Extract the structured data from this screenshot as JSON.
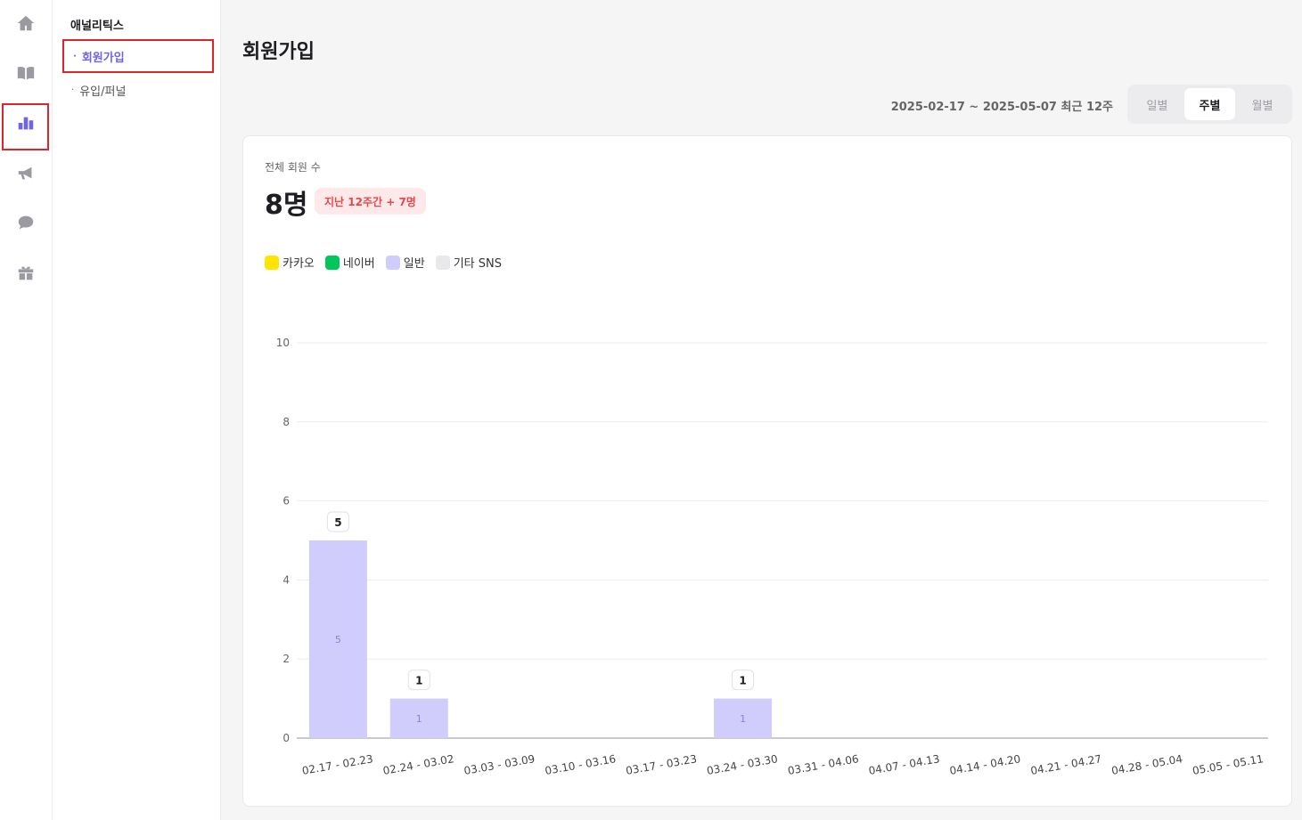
{
  "rail": {
    "items": [
      {
        "icon": "home-icon",
        "name": "rail-home"
      },
      {
        "icon": "book-icon",
        "name": "rail-book"
      },
      {
        "icon": "bar-chart-icon",
        "name": "rail-analytics",
        "active": true
      },
      {
        "icon": "megaphone-icon",
        "name": "rail-marketing"
      },
      {
        "icon": "chat-bubble-icon",
        "name": "rail-chat"
      },
      {
        "icon": "gift-icon",
        "name": "rail-gift"
      }
    ]
  },
  "subnav": {
    "title": "애널리틱스",
    "items": [
      {
        "label": "회원가입",
        "active": true
      },
      {
        "label": "유입/퍼널",
        "active": false
      }
    ]
  },
  "page": {
    "title": "회원가입",
    "range_text": "2025-02-17 ~ 2025-05-07 최근 12주"
  },
  "period_toggle": {
    "options": [
      "일별",
      "주별",
      "월별"
    ],
    "selected": "주별"
  },
  "card": {
    "label": "전체 회원 수",
    "total": "8명",
    "badge": "지난 12주간 + 7명"
  },
  "legend": [
    {
      "label": "카카오",
      "color": "#fee500"
    },
    {
      "label": "네이버",
      "color": "#03c75a"
    },
    {
      "label": "일반",
      "color": "#d0ccfb"
    },
    {
      "label": "기타 SNS",
      "color": "#e9e9ec"
    }
  ],
  "chart_data": {
    "type": "bar",
    "stacked": true,
    "categories": [
      "02.17 - 02.23",
      "02.24 - 03.02",
      "03.03 - 03.09",
      "03.10 - 03.16",
      "03.17 - 03.23",
      "03.24 - 03.30",
      "03.31 - 04.06",
      "04.07 - 04.13",
      "04.14 - 04.20",
      "04.21 - 04.27",
      "04.28 - 05.04",
      "05.05 - 05.11"
    ],
    "series": [
      {
        "name": "카카오",
        "color": "#fee500",
        "values": [
          0,
          0,
          0,
          0,
          0,
          0,
          0,
          0,
          0,
          0,
          0,
          0
        ]
      },
      {
        "name": "네이버",
        "color": "#03c75a",
        "values": [
          0,
          0,
          0,
          0,
          0,
          0,
          0,
          0,
          0,
          0,
          0,
          0
        ]
      },
      {
        "name": "일반",
        "color": "#d0ccfb",
        "values": [
          5,
          1,
          0,
          0,
          0,
          1,
          0,
          0,
          0,
          0,
          0,
          0
        ]
      },
      {
        "name": "기타 SNS",
        "color": "#e9e9ec",
        "values": [
          0,
          0,
          0,
          0,
          0,
          0,
          0,
          0,
          0,
          0,
          0,
          0
        ]
      }
    ],
    "ylim": [
      0,
      10
    ],
    "yticks": [
      0,
      2,
      4,
      6,
      8,
      10
    ],
    "grid": true,
    "legend_position": "top-left"
  }
}
